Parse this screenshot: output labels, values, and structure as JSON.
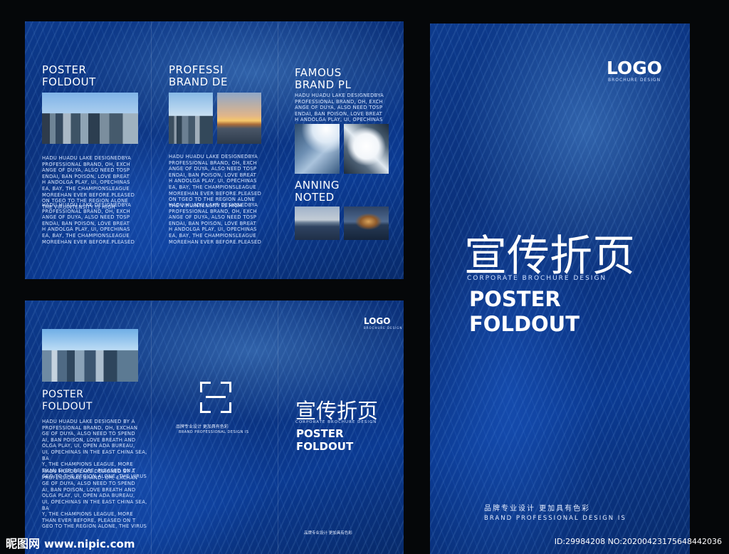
{
  "inside_spread": {
    "col1": {
      "title_line1": "POSTER",
      "title_line2": "FOLDOUT",
      "text1": "HADU HUADU LAKE DESIGNEDBYA\nPROFESSIONAL BRAND, OH, EXCH\nANGE OF DUYA, ALSO NEED TOSP\nENDAI, BAN POISON, LOVE BREAT\nH ANDOLGA PLAY, UI, OPECHINAS\nEA, BAY, THE CHAMPIONSLEAGUE\nMOREEHAN EVER BEFORE.PLEASED\nON TGEO TO THE REGION ALONE\nTHE VIRUINTENSITY IS HIGH",
      "text2": "HADU HUADU LAKE DESIGNEDBYA\nPROFESSIONAL BRAND, OH, EXCH\nANGE OF DUYA, ALSO NEED TOSP\nENDAI, BAN POISON, LOVE BREAT\nH ANDOLGA PLAY, UI, OPECHINAS\nEA, BAY, THE CHAMPIONSLEAGUE\nMOREEHAN EVER BEFORE.PLEASED"
    },
    "col2": {
      "title_line1": "PROFESSI",
      "title_line2": "BRAND DE",
      "text1": "HADU HUADU LAKE DESIGNEDBYA\nPROFESSIONAL BRAND, OH, EXCH\nANGE OF DUYA, ALSO NEED TOSP\nENDAI, BAN POISON, LOVE BREAT\nH ANDOLGA PLAY, UI, OPECHINAS\nEA, BAY, THE CHAMPIONSLEAGUE\nMOREEHAN EVER BEFORE.PLEASED\nON TGEO TO THE REGION ALONE\nTHE VIRUINTENSITY IS HIGH",
      "text2": "HADU HUADU LAKE DESIGNEDBYA\nPROFESSIONAL BRAND, OH, EXCH\nANGE OF DUYA, ALSO NEED TOSP\nENDAI, BAN POISON, LOVE BREAT\nH ANDOLGA PLAY, UI, OPECHINAS\nEA, BAY, THE CHAMPIONSLEAGUE\nMOREEHAN EVER BEFORE.PLEASED"
    },
    "col3": {
      "title_line1": "FAMOUS",
      "title_line2": "BRAND PL",
      "text1": "HADU HUADU LAKE DESIGNEDBYA\nPROFESSIONAL BRAND, OH, EXCH\nANGE OF DUYA, ALSO NEED TOSP\nENDAI, BAN POISON, LOVE BREAT\nH ANDOLGA PLAY, UI, OPECHINAS",
      "subtitle_line1": "ANNING",
      "subtitle_line2": "NOTED"
    }
  },
  "outside_spread": {
    "logo": "LOGO",
    "logo_sub": "BROCHURE DESIGN",
    "left_col": {
      "title_line1": "POSTER",
      "title_line2": "FOLDOUT",
      "text1": "HADU HUADU LAKE DESIGNED BY A\nPROFESSIONAL BRAND, OH, EXCHAN\nGE OF DUYA, ALSO NEED TO SPEND\nAI, BAN POISON, LOVE BREATH AND\nOLGA PLAY, UI, OPEN ADA BUREAU,\nUI, OPECHINAS IN THE EAST CHINA SEA, BA\nY, THE CHAMPIONS LEAGUE, MORE\nTHAN EVER BEFORE, PLEASED ON T\nGEO TO THE REGION ALONE, THE VIRUS\nINTENSITY IS HIGH",
      "text2": "HADU HUADU LAKE DESIGNED BY A\nPROFESSIONAL BRAND, OH, EXCHAN\nGE OF DUYA, ALSO NEED TO SPEND\nAI, BAN POISON, LOVE BREATH AND\nOLGA PLAY, UI, OPEN ADA BUREAU,\nUI, OPECHINAS IN THE EAST CHINA SEA, BA\nY, THE CHAMPIONS LEAGUE, MORE\nTHAN EVER BEFORE, PLEASED ON T\nGEO TO THE REGION ALONE, THE VIRUS\nINTENSITY IS HIGH"
    },
    "middle": {
      "tagline_cn": "品牌专业设计  更加具有色彩",
      "tagline_en": "BRAND PROFESSIONAL DESIGN IS"
    },
    "cover": {
      "title_cn": "宣传折页",
      "subtitle_en": "CORPORATE BROCHURE DESIGN",
      "big_line1": "POSTER",
      "big_line2": "FOLDOUT",
      "bottom_cn": "品牌专业设计  更加具有色彩"
    }
  },
  "front_cover": {
    "logo": "LOGO",
    "logo_sub": "BROCHURE DESIGN",
    "title_cn": "宣传折页",
    "subtitle_en": "CORPORATE BROCHURE DESIGN",
    "big_line1": "POSTER",
    "big_line2": "FOLDOUT",
    "bottom_cn": "品牌专业设计  更加具有色彩",
    "bottom_en": "BRAND PROFESSIONAL DESIGN IS"
  },
  "watermark": {
    "site_cn": "昵图网",
    "site_url": "www.nipic.com",
    "id_text": "ID:29984208 NO:20200423175648442036"
  }
}
